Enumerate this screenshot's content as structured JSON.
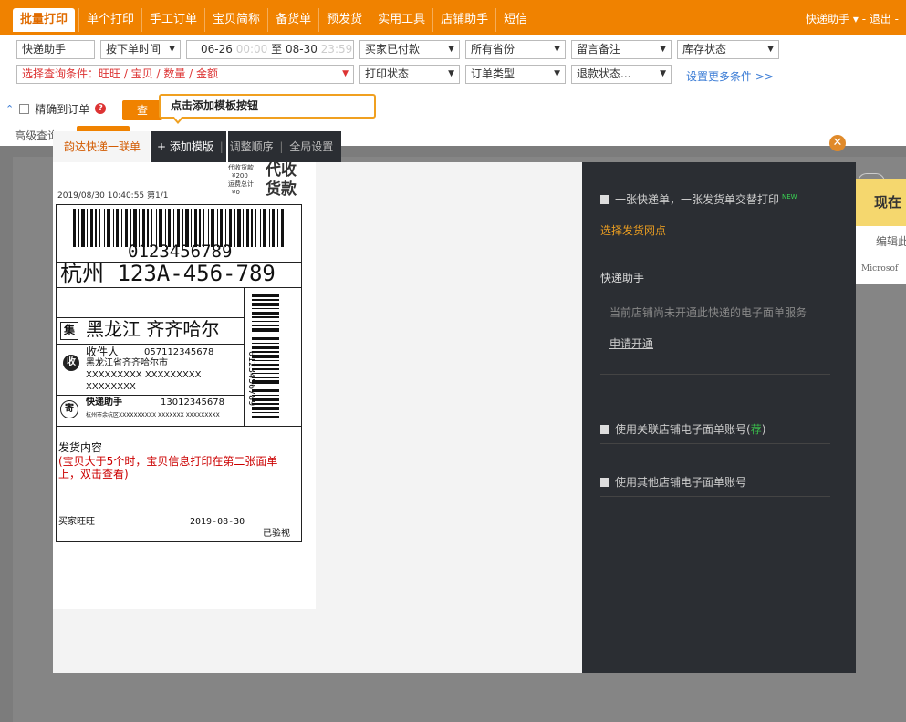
{
  "nav": {
    "tabs": [
      "批量打印",
      "单个打印",
      "手工订单",
      "宝贝简称",
      "备货单",
      "预发货",
      "实用工具",
      "店铺助手",
      "短信"
    ],
    "user": "快递助手 ▾ - 退出 -"
  },
  "filters": {
    "row1": {
      "shop": "快递助手",
      "order_time": "按下单时间",
      "date_start": "06-26",
      "time_start": "00:00",
      "to": "至",
      "date_end": "08-30",
      "time_end": "23:59",
      "pay_status": "买家已付款",
      "province": "所有省份",
      "memo": "留言备注",
      "stock": "库存状态"
    },
    "row2": {
      "query_condition": "选择查询条件：旺旺 / 宝贝 / 数量 / 金额",
      "print_status": "打印状态",
      "order_type": "订单类型",
      "refund_status": "退款状态...",
      "more_conditions": "设置更多条件 >>"
    },
    "exact_match": "精确到订单",
    "search": "查",
    "advanced": "高级查询"
  },
  "tooltip": "点击添加模板按钮",
  "modal": {
    "template_tab": "韵达快递一联单",
    "add_template": "+ 添加模版",
    "sep": "|",
    "reorder": "调整顺序",
    "global_settings": "全局设置",
    "close": "✕"
  },
  "label": {
    "cod_amount_label": "代收货款",
    "cod_amount": "¥200",
    "freight_label": "运费总计",
    "freight": "¥0",
    "cod_title_1": "代收",
    "cod_title_2": "货款",
    "datetime": "2019/08/30 10:40:55",
    "page": "第1/1",
    "barcode_number": "0123456789",
    "origin_code": "杭州 123A-456-789",
    "vertical_barcode_number": "0123456789",
    "dest_icon": "集",
    "destination": "黑龙江 齐齐哈尔",
    "receiver_icon": "收",
    "receiver_name": "收件人",
    "receiver_phone": "057112345678",
    "receiver_addr1": "黑龙江省齐齐哈尔市",
    "receiver_addr2": "XXXXXXXXX XXXXXXXXX",
    "receiver_addr3": "XXXXXXXX",
    "sender_icon": "寄",
    "sender_name": "快递助手",
    "sender_phone": "13012345678",
    "sender_addr": "杭州市余杭区XXXXXXXXXX XXXXXXX XXXXXXXXX",
    "content_title": "发货内容",
    "content_note": "(宝贝大于5个时，宝贝信息打印在第二张面单上，双击查看)",
    "buyer": "买家旺旺",
    "ship_date": "2019-08-30",
    "verified": "已验视"
  },
  "panel": {
    "alt_print": "一张快递单，一张发货单交替打印",
    "new": "NEW",
    "select_outlet": "选择发货网点",
    "provider": "快递助手",
    "not_opened": "当前店铺尚未开通此快递的电子面单服务",
    "apply": "申请开通",
    "use_related_prefix": "使用关联店铺电子面单账号(",
    "use_related_link": "荐",
    "use_related_suffix": ")",
    "use_other": "使用其他店铺电子面单账号"
  },
  "edge": {
    "now": "现在",
    "edit": "编辑此",
    "ms": "Microsof"
  }
}
